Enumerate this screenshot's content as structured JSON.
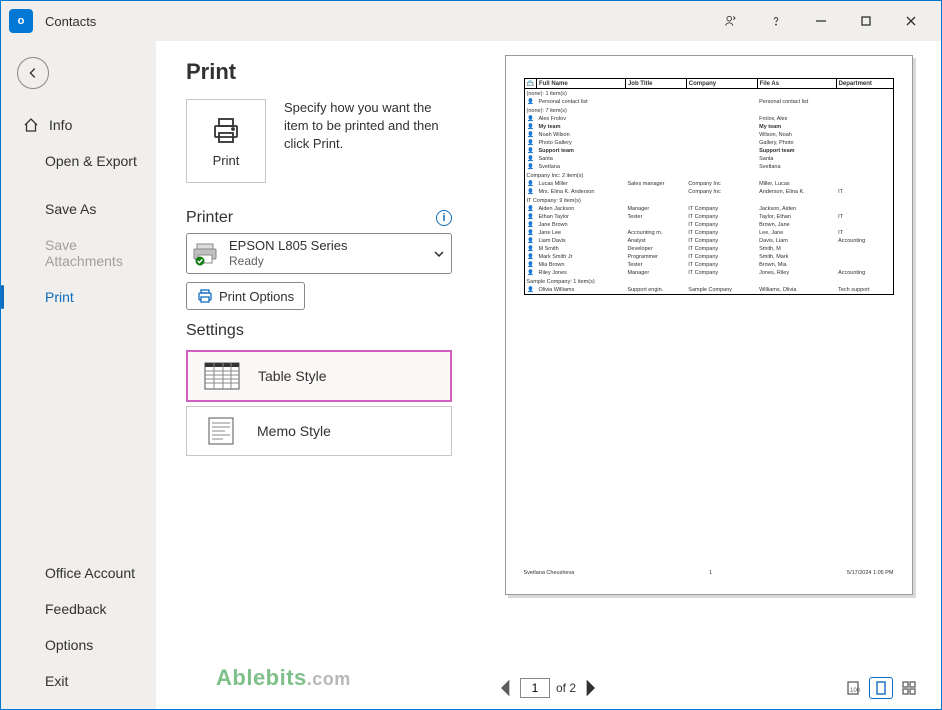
{
  "app": {
    "title": "Contacts"
  },
  "sidebar": {
    "info": "Info",
    "open_export": "Open & Export",
    "save_as": "Save As",
    "save_attachments": "Save Attachments",
    "print": "Print",
    "office_account": "Office Account",
    "feedback": "Feedback",
    "options": "Options",
    "exit": "Exit"
  },
  "panel": {
    "title": "Print",
    "print_btn": "Print",
    "description": "Specify how you want the item to be printed and then click Print.",
    "printer_heading": "Printer",
    "printer_name": "EPSON L805 Series",
    "printer_status": "Ready",
    "print_options": "Print Options",
    "settings_heading": "Settings",
    "style_table": "Table Style",
    "style_memo": "Memo Style"
  },
  "watermark": {
    "brand": "Ablebits",
    "dot": ".com"
  },
  "preview": {
    "headers": {
      "full_name": "Full Name",
      "job_title": "Job Title",
      "company": "Company",
      "file_as": "File As",
      "department": "Department"
    },
    "groups": [
      {
        "label": "(none): 1 item(s)",
        "rows": [
          {
            "full_name": "Personal contact list",
            "job_title": "",
            "company": "",
            "file_as": "Personal contact list",
            "department": ""
          }
        ]
      },
      {
        "label": "(none): 7 item(s)",
        "rows": [
          {
            "full_name": "Alex Frolov",
            "job_title": "",
            "company": "",
            "file_as": "Frolov, Alex",
            "department": ""
          },
          {
            "full_name": "My team",
            "job_title": "",
            "company": "",
            "file_as": "My team",
            "department": "",
            "bold": true
          },
          {
            "full_name": "Noah Wilson",
            "job_title": "",
            "company": "",
            "file_as": "Wilson, Noah",
            "department": ""
          },
          {
            "full_name": "Photo Gallery",
            "job_title": "",
            "company": "",
            "file_as": "Gallery, Photo",
            "department": ""
          },
          {
            "full_name": "Support team",
            "job_title": "",
            "company": "",
            "file_as": "Support team",
            "department": "",
            "bold": true
          },
          {
            "full_name": "Santa",
            "job_title": "",
            "company": "",
            "file_as": "Santa",
            "department": ""
          },
          {
            "full_name": "Svetlana",
            "job_title": "",
            "company": "",
            "file_as": "Svetlana",
            "department": ""
          }
        ]
      },
      {
        "label": "Company Inc: 2 item(s)",
        "rows": [
          {
            "full_name": "Lucas Miller",
            "job_title": "Sales manager",
            "company": "Company Inc",
            "file_as": "Miller, Lucas",
            "department": ""
          },
          {
            "full_name": "Mrs. Elina K. Anderson",
            "job_title": "",
            "company": "Company Inc",
            "file_as": "Anderson, Elina K.",
            "department": "IT"
          }
        ]
      },
      {
        "label": "IT Company: 9 item(s)",
        "rows": [
          {
            "full_name": "Aiden Jackson",
            "job_title": "Manager",
            "company": "IT Company",
            "file_as": "Jackson, Aiden",
            "department": ""
          },
          {
            "full_name": "Ethan Taylor",
            "job_title": "Tester",
            "company": "IT Company",
            "file_as": "Taylor, Ethan",
            "department": "IT"
          },
          {
            "full_name": "Jane Brown",
            "job_title": "",
            "company": "IT Company",
            "file_as": "Brown, Jane",
            "department": ""
          },
          {
            "full_name": "Jane Lee",
            "job_title": "Accounting m.",
            "company": "IT Company",
            "file_as": "Lee, Jane",
            "department": "IT"
          },
          {
            "full_name": "Liam Davis",
            "job_title": "Analyst",
            "company": "IT Company",
            "file_as": "Davis, Liam",
            "department": "Accounting"
          },
          {
            "full_name": "M Smith",
            "job_title": "Developer",
            "company": "IT Company",
            "file_as": "Smith, M",
            "department": ""
          },
          {
            "full_name": "Mark Smith Jr",
            "job_title": "Programmer",
            "company": "IT Company",
            "file_as": "Smith, Mark",
            "department": ""
          },
          {
            "full_name": "Mia Brown",
            "job_title": "Tester",
            "company": "IT Company",
            "file_as": "Brown, Mia",
            "department": ""
          },
          {
            "full_name": "Riley Jones",
            "job_title": "Manager",
            "company": "IT Company",
            "file_as": "Jones, Riley",
            "department": "Accounting"
          }
        ]
      },
      {
        "label": "Sample Company: 1 item(s)",
        "rows": [
          {
            "full_name": "Olivia Williams",
            "job_title": "Support engin.",
            "company": "Sample Company",
            "file_as": "Williams, Olivia",
            "department": "Tech support"
          }
        ]
      }
    ],
    "footer_left": "Svetlana Cheusheva",
    "footer_center": "1",
    "footer_right": "5/17/2024  1:05 PM"
  },
  "pager": {
    "current": "1",
    "of_label": "of 2"
  }
}
